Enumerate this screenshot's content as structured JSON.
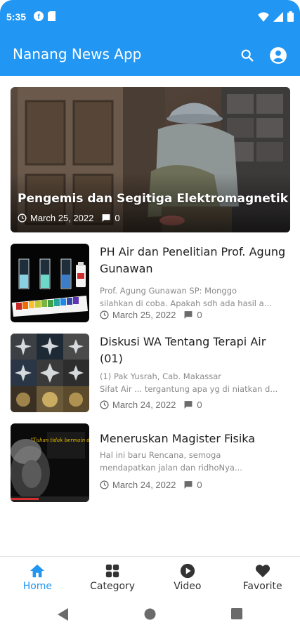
{
  "status_bar": {
    "time": "5:35",
    "icons": [
      "f-app-icon",
      "sim-card-icon",
      "wifi-icon",
      "signal-icon",
      "battery-icon"
    ]
  },
  "app_bar": {
    "title": "Nanang News App",
    "actions": [
      "search-icon",
      "account-circle-icon"
    ]
  },
  "featured": {
    "title": "Pengemis dan Segitiga Elektromagnetik",
    "date": "March 25, 2022",
    "comments": "0"
  },
  "news": [
    {
      "title": "PH Air dan Penelitian Prof. Agung Gunawan",
      "excerpt_lines": [
        "Prof. Agung Gunawan SP: Monggo silahkan di coba. Apakah sdh ada hasil a..."
      ],
      "excerpt_line1": "Prof. Agung Gunawan SP: Monggo",
      "excerpt_line2": "silahkan di coba. Apakah sdh ada hasil a...",
      "date": "March 25, 2022",
      "comments": "0"
    },
    {
      "title": "Diskusi WA Tentang Terapi Air (01)",
      "excerpt_line1": "(1) Pak Yusrah, Cab. Makassar",
      "excerpt_line2": "Sifat Air ... tergantung apa yg di niatkan d...",
      "date": "March 24, 2022",
      "comments": "0"
    },
    {
      "title": "Meneruskan Magister Fisika",
      "excerpt_line1": "Hal ini baru Rencana, semoga",
      "excerpt_line2": "mendapatkan jalan dan ridhoNya...",
      "date": "March 24, 2022",
      "comments": "0"
    }
  ],
  "thumb_caption": "\"Tuhan tidak bermain dadu\"",
  "bottom_nav": {
    "items": [
      {
        "label": "Home",
        "icon": "home-icon",
        "active": true
      },
      {
        "label": "Category",
        "icon": "grid-icon",
        "active": false
      },
      {
        "label": "Video",
        "icon": "play-circle-icon",
        "active": false
      },
      {
        "label": "Favorite",
        "icon": "heart-icon",
        "active": false
      }
    ]
  },
  "colors": {
    "primary": "#2196f3",
    "text": "#1e1e1e",
    "muted": "#8a8a8a"
  }
}
